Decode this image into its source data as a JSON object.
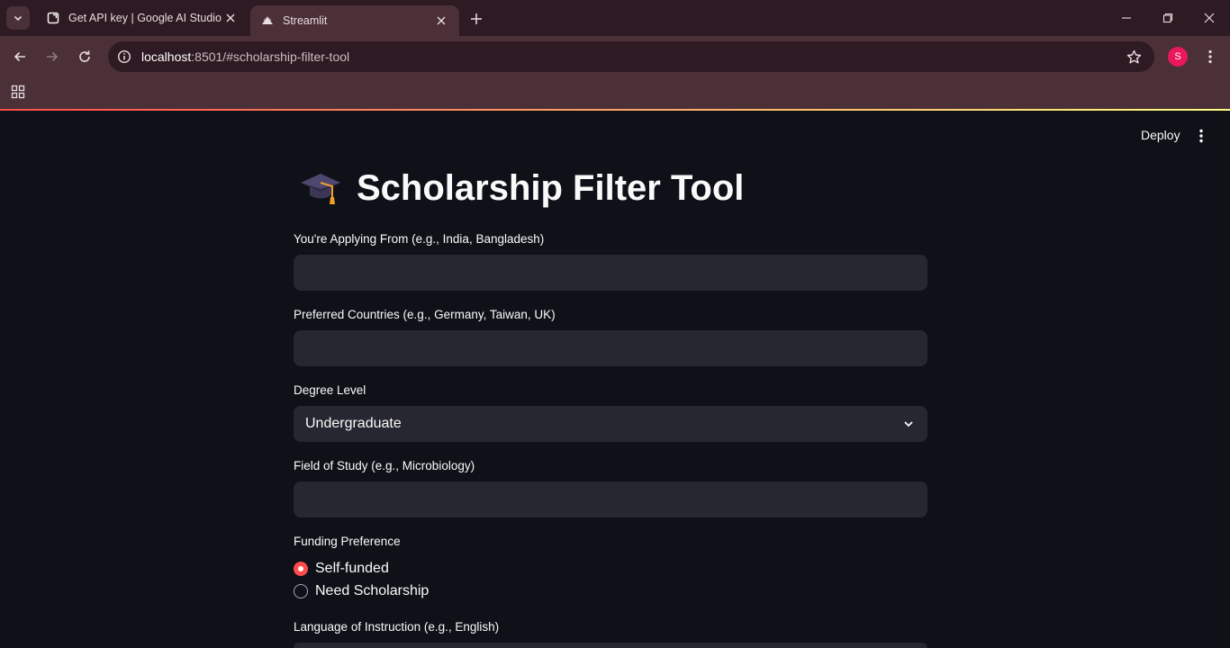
{
  "browser": {
    "tabs": [
      {
        "title": "Get API key | Google AI Studio",
        "active": false
      },
      {
        "title": "Streamlit",
        "active": true
      }
    ],
    "url": {
      "host": "localhost",
      "rest": ":8501/#scholarship-filter-tool"
    },
    "profile_initial": "S"
  },
  "app": {
    "deploy_label": "Deploy",
    "title": "Scholarship Filter Tool",
    "title_icon": "graduation-cap-emoji",
    "fields": {
      "applying_from": {
        "label": "You're Applying From (e.g., India, Bangladesh)",
        "value": ""
      },
      "preferred_countries": {
        "label": "Preferred Countries (e.g., Germany, Taiwan, UK)",
        "value": ""
      },
      "degree_level": {
        "label": "Degree Level",
        "value": "Undergraduate"
      },
      "field_of_study": {
        "label": "Field of Study (e.g., Microbiology)",
        "value": ""
      },
      "funding": {
        "label": "Funding Preference",
        "options": [
          "Self-funded",
          "Need Scholarship"
        ],
        "selected": "Self-funded"
      },
      "language": {
        "label": "Language of Instruction (e.g., English)"
      }
    }
  },
  "colors": {
    "primary": "#ff4b4b",
    "background": "#0e1117",
    "input_bg": "#262730"
  }
}
